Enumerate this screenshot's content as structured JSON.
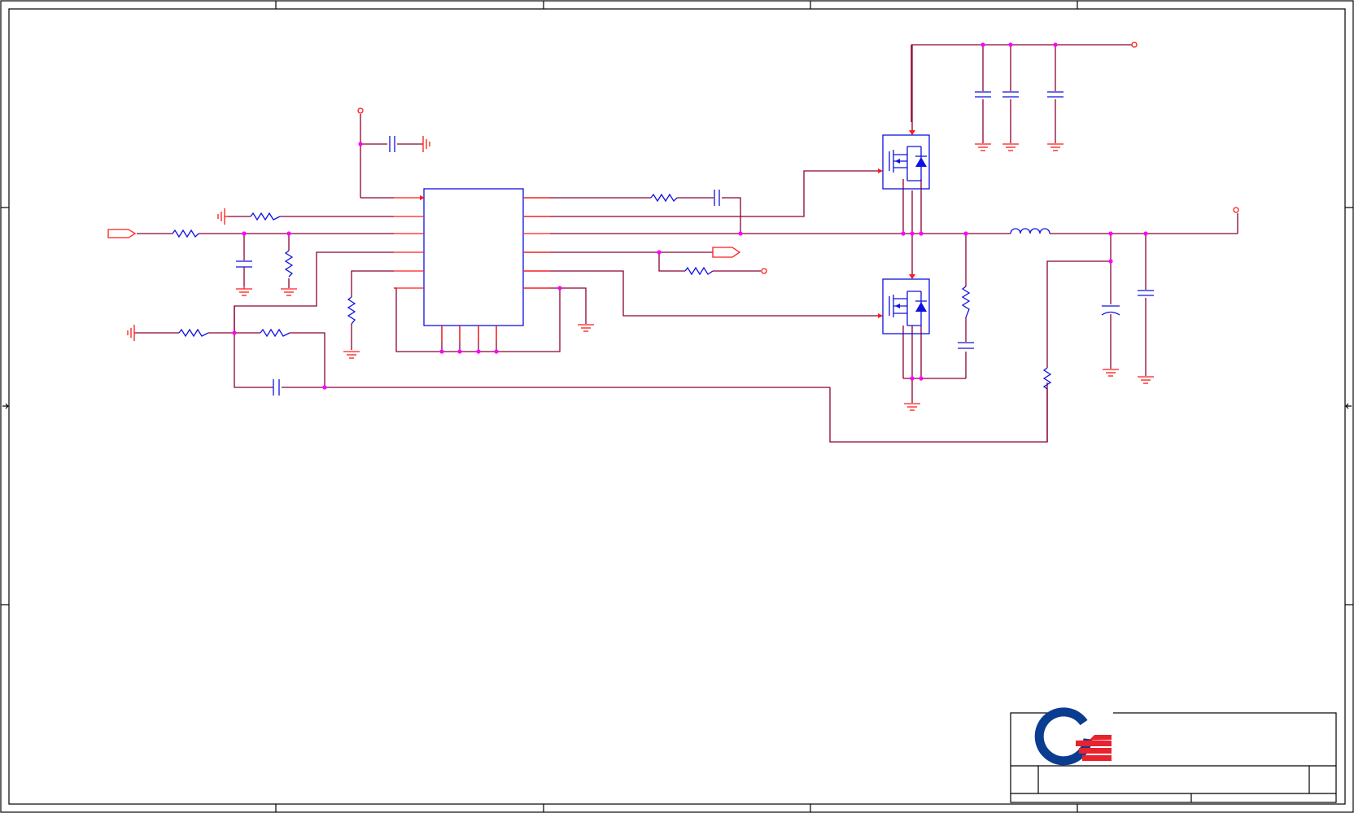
{
  "schematic": {
    "colors": {
      "wire": "#8b0035",
      "pin": "#ff1a1a",
      "component": "#1010e0",
      "junction": "#ff00ff",
      "frame": "#000000",
      "logo_blue": "#0a3d8f",
      "logo_red": "#e8222e"
    },
    "components": [
      {
        "kind": "controller-ic-icon"
      },
      {
        "kind": "high-side-mosfet-icon"
      },
      {
        "kind": "low-side-mosfet-icon"
      },
      {
        "kind": "output-inductor-icon"
      },
      {
        "kind": "resistor-icon"
      },
      {
        "kind": "capacitor-icon"
      },
      {
        "kind": "ground-symbol-icon"
      },
      {
        "kind": "offpage-connector-icon"
      },
      {
        "kind": "power-rail-icon"
      }
    ],
    "title_block": {
      "logo_icon": "company-q-logo-icon"
    }
  }
}
